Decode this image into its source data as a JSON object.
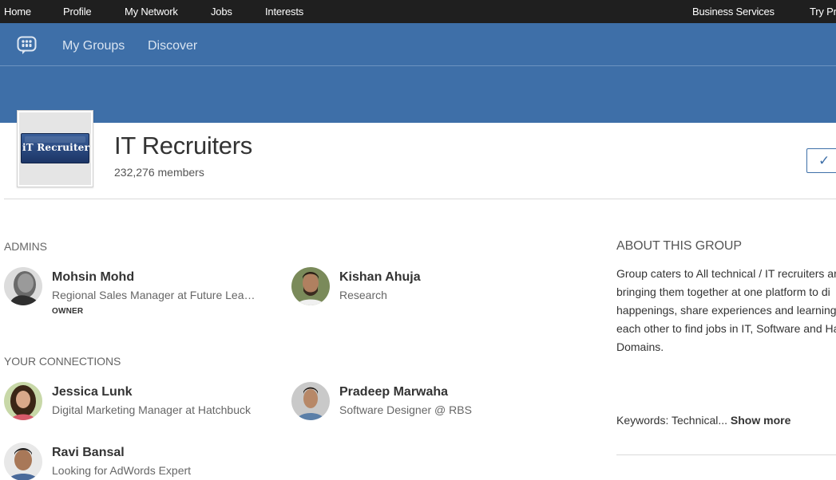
{
  "topnav": {
    "items": [
      "Home",
      "Profile",
      "My Network",
      "Jobs",
      "Interests"
    ],
    "right_items": [
      "Business Services",
      "Try Pr"
    ]
  },
  "subnav": {
    "icon": "groups-icon",
    "my_groups": "My Groups",
    "discover": "Discover"
  },
  "group": {
    "logo_text": "iT Recruiter",
    "name": "IT Recruiters",
    "members": "232,276 members",
    "joined_icon": "✓"
  },
  "admins": {
    "label": "ADMINS",
    "people": [
      {
        "name": "Mohsin Mohd",
        "title": "Regional Sales Manager at Future Lea…",
        "role": "OWNER"
      },
      {
        "name": "Kishan Ahuja",
        "title": "Research"
      }
    ]
  },
  "connections": {
    "label": "YOUR CONNECTIONS",
    "people": [
      {
        "name": "Jessica Lunk",
        "title": "Digital Marketing Manager at Hatchbuck"
      },
      {
        "name": "Pradeep Marwaha",
        "title": "Software Designer @ RBS"
      },
      {
        "name": "Ravi Bansal",
        "title": "Looking for AdWords Expert"
      }
    ]
  },
  "about": {
    "title": "ABOUT THIS GROUP",
    "lines": [
      "Group caters to All technical / IT recruiters ar",
      "bringing them together at one platform to di",
      "happenings, share experiences and learning",
      "each other to find jobs in IT, Software and Ha",
      "Domains."
    ],
    "keywords": "Keywords: Technical...",
    "show_more": "Show more"
  },
  "colors": {
    "topnav_bg": "#1f1f1f",
    "header_blue": "#3e6fa8"
  }
}
